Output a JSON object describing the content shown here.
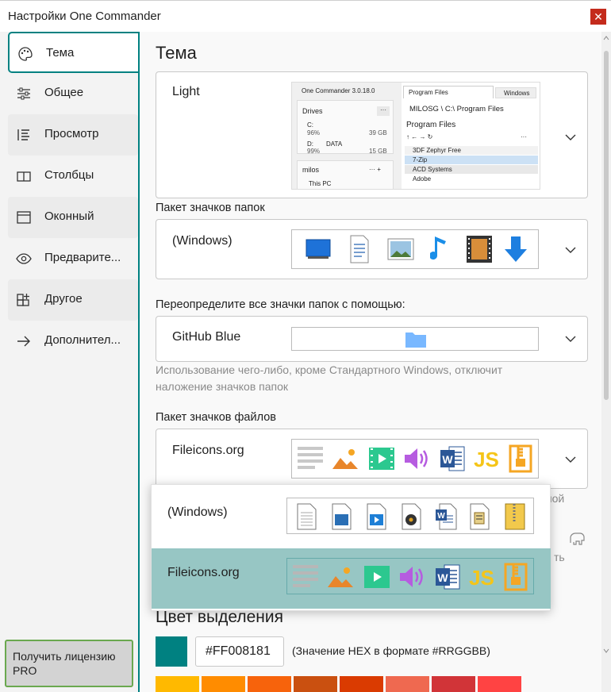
{
  "window": {
    "title": "Настройки One Commander",
    "close_glyph": "✕"
  },
  "sidebar": {
    "items": [
      {
        "label": "Тема",
        "icon": "palette-icon",
        "active": true
      },
      {
        "label": "Общее",
        "icon": "sliders-icon"
      },
      {
        "label": "Просмотр",
        "icon": "list-view-icon"
      },
      {
        "label": "Столбцы",
        "icon": "columns-icon"
      },
      {
        "label": "Оконный",
        "icon": "window-icon"
      },
      {
        "label": "Предварите...",
        "icon": "eye-icon"
      },
      {
        "label": "Другое",
        "icon": "apps-add-icon"
      },
      {
        "label": "Дополнител...",
        "icon": "arrow-right-icon"
      }
    ],
    "license_button": "Получить лицензию PRO"
  },
  "main": {
    "title": "Тема",
    "theme": {
      "value": "Light",
      "preview": {
        "app_title": "One Commander 3.0.18.0",
        "tab1": "Program Files",
        "tab2": "Windows",
        "drives_header": "Drives",
        "drives_more": "···",
        "drive_c_label": "C:",
        "drive_c_pct": "96%",
        "drive_c_free": "39 GB",
        "drive_d_label": "D:",
        "drive_d_name": "DATA",
        "drive_d_pct": "99%",
        "drive_d_free": "15 GB",
        "user_header": "milos",
        "user_more": "··· +",
        "this_pc": "This PC",
        "path": "MILOSG \\ C:\\ Program Files",
        "folder_title": "Program Files",
        "nav_arrows": "↑ ← → ↻",
        "nav_more": "···",
        "files": [
          "3DF Zephyr Free",
          "7-Zip",
          "ACD Systems",
          "Adobe"
        ]
      }
    },
    "folder_pack_label": "Пакет значков папок",
    "folder_pack": {
      "value": "(Windows)"
    },
    "override_label": "Переопределите все значки папок с помощью:",
    "override": {
      "value": "GitHub Blue"
    },
    "override_hint": "Использование чего-либо, кроме Стандартного Windows, отключит наложение значков папок",
    "file_pack_label": "Пакет значков файлов",
    "file_pack": {
      "value": "Fileicons.org"
    },
    "partial_hint": "мой",
    "partial_hint2": "ть",
    "highlight_title": "Цвет выделения",
    "color": {
      "hex_value": "#FF008181",
      "hex_hint": "(Значение HEX в формате #RRGGBB)",
      "current_swatch": "#008181",
      "palette": [
        "#ffb900",
        "#ff8c00",
        "#f7630c",
        "#ca5010",
        "#da3b01",
        "#ef6950",
        "#d13438",
        "#ff4343"
      ]
    }
  },
  "dropdown": {
    "options": [
      {
        "label": "(Windows)",
        "selected": false
      },
      {
        "label": "Fileicons.org",
        "selected": true
      }
    ]
  }
}
